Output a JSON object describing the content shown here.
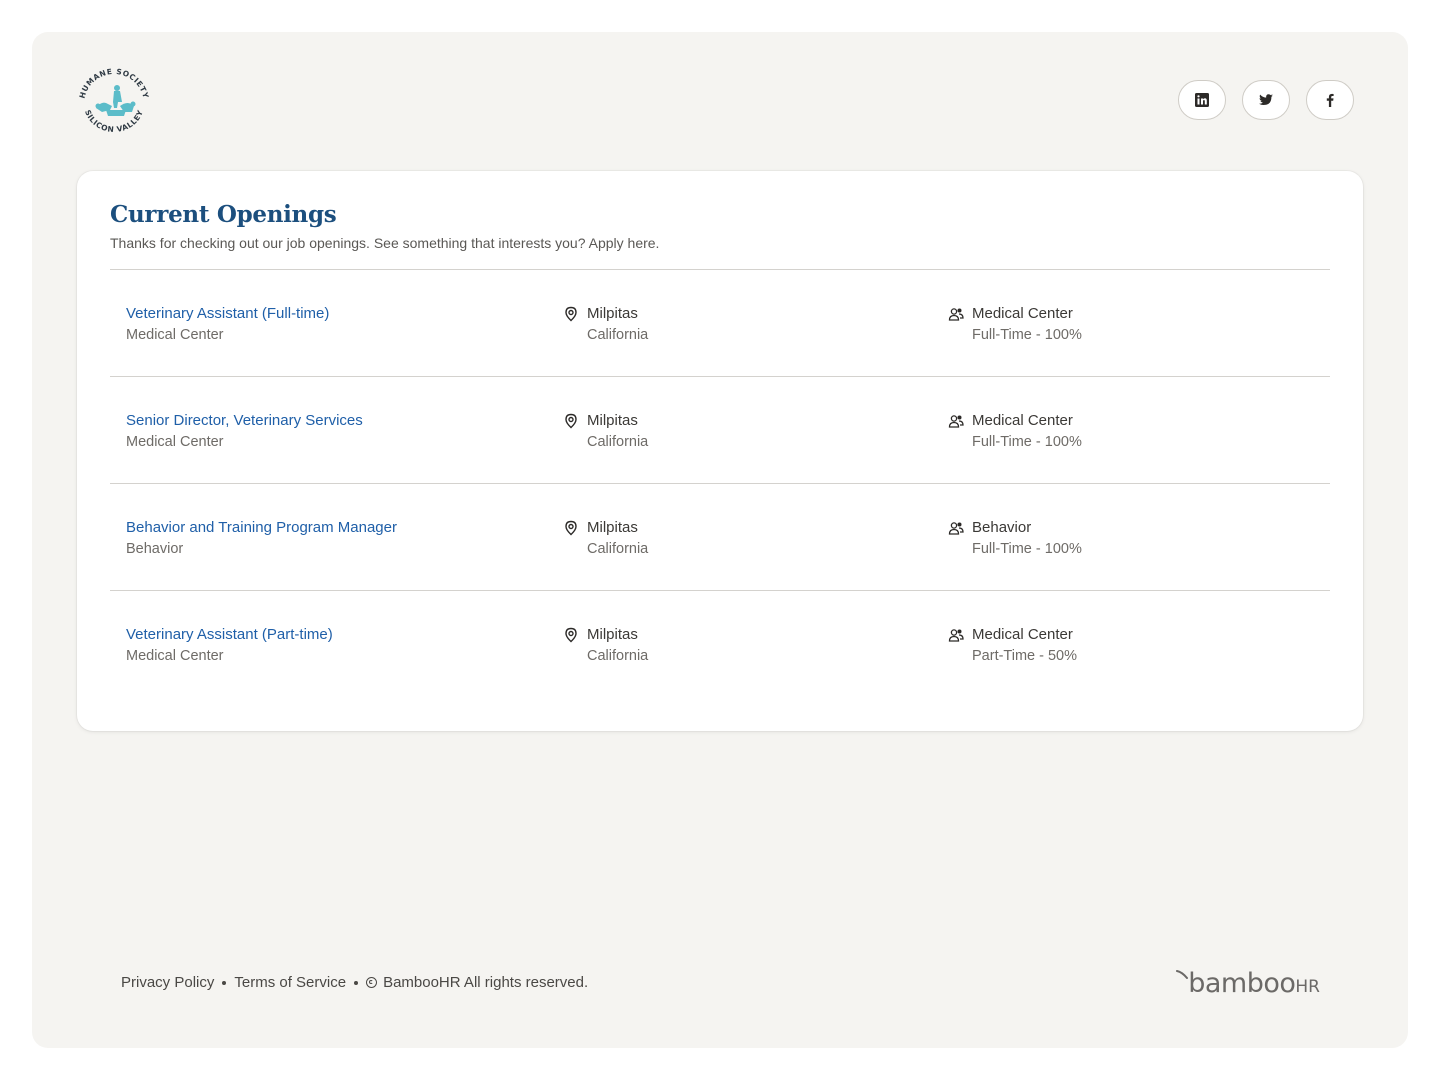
{
  "header": {
    "logo_top_text": "HUMANE SOCIETY",
    "logo_bottom_text": "SILICON VALLEY",
    "social": [
      {
        "name": "linkedin",
        "icon": "linkedin-icon"
      },
      {
        "name": "twitter",
        "icon": "twitter-icon"
      },
      {
        "name": "facebook",
        "icon": "facebook-icon"
      }
    ]
  },
  "openings": {
    "title": "Current Openings",
    "subtitle": "Thanks for checking out our job openings. See something that interests you? Apply here.",
    "jobs": [
      {
        "title": "Veterinary Assistant (Full-time)",
        "department": "Medical Center",
        "city": "Milpitas",
        "state": "California",
        "dept_label": "Medical Center",
        "employment": "Full-Time - 100%"
      },
      {
        "title": "Senior Director, Veterinary Services",
        "department": "Medical Center",
        "city": "Milpitas",
        "state": "California",
        "dept_label": "Medical Center",
        "employment": "Full-Time - 100%"
      },
      {
        "title": "Behavior and Training Program Manager",
        "department": "Behavior",
        "city": "Milpitas",
        "state": "California",
        "dept_label": "Behavior",
        "employment": "Full-Time - 100%"
      },
      {
        "title": "Veterinary Assistant (Part-time)",
        "department": "Medical Center",
        "city": "Milpitas",
        "state": "California",
        "dept_label": "Medical Center",
        "employment": "Part-Time - 50%"
      }
    ]
  },
  "footer": {
    "privacy": "Privacy Policy",
    "terms": "Terms of Service",
    "copyright": "BambooHR All rights reserved.",
    "brand_main": "bamboo",
    "brand_hr": "HR"
  },
  "colors": {
    "title_blue": "#1c4f7e",
    "link_blue": "#1f5fa8",
    "page_bg": "#f5f4f1",
    "logo_teal": "#5bbcc9"
  }
}
